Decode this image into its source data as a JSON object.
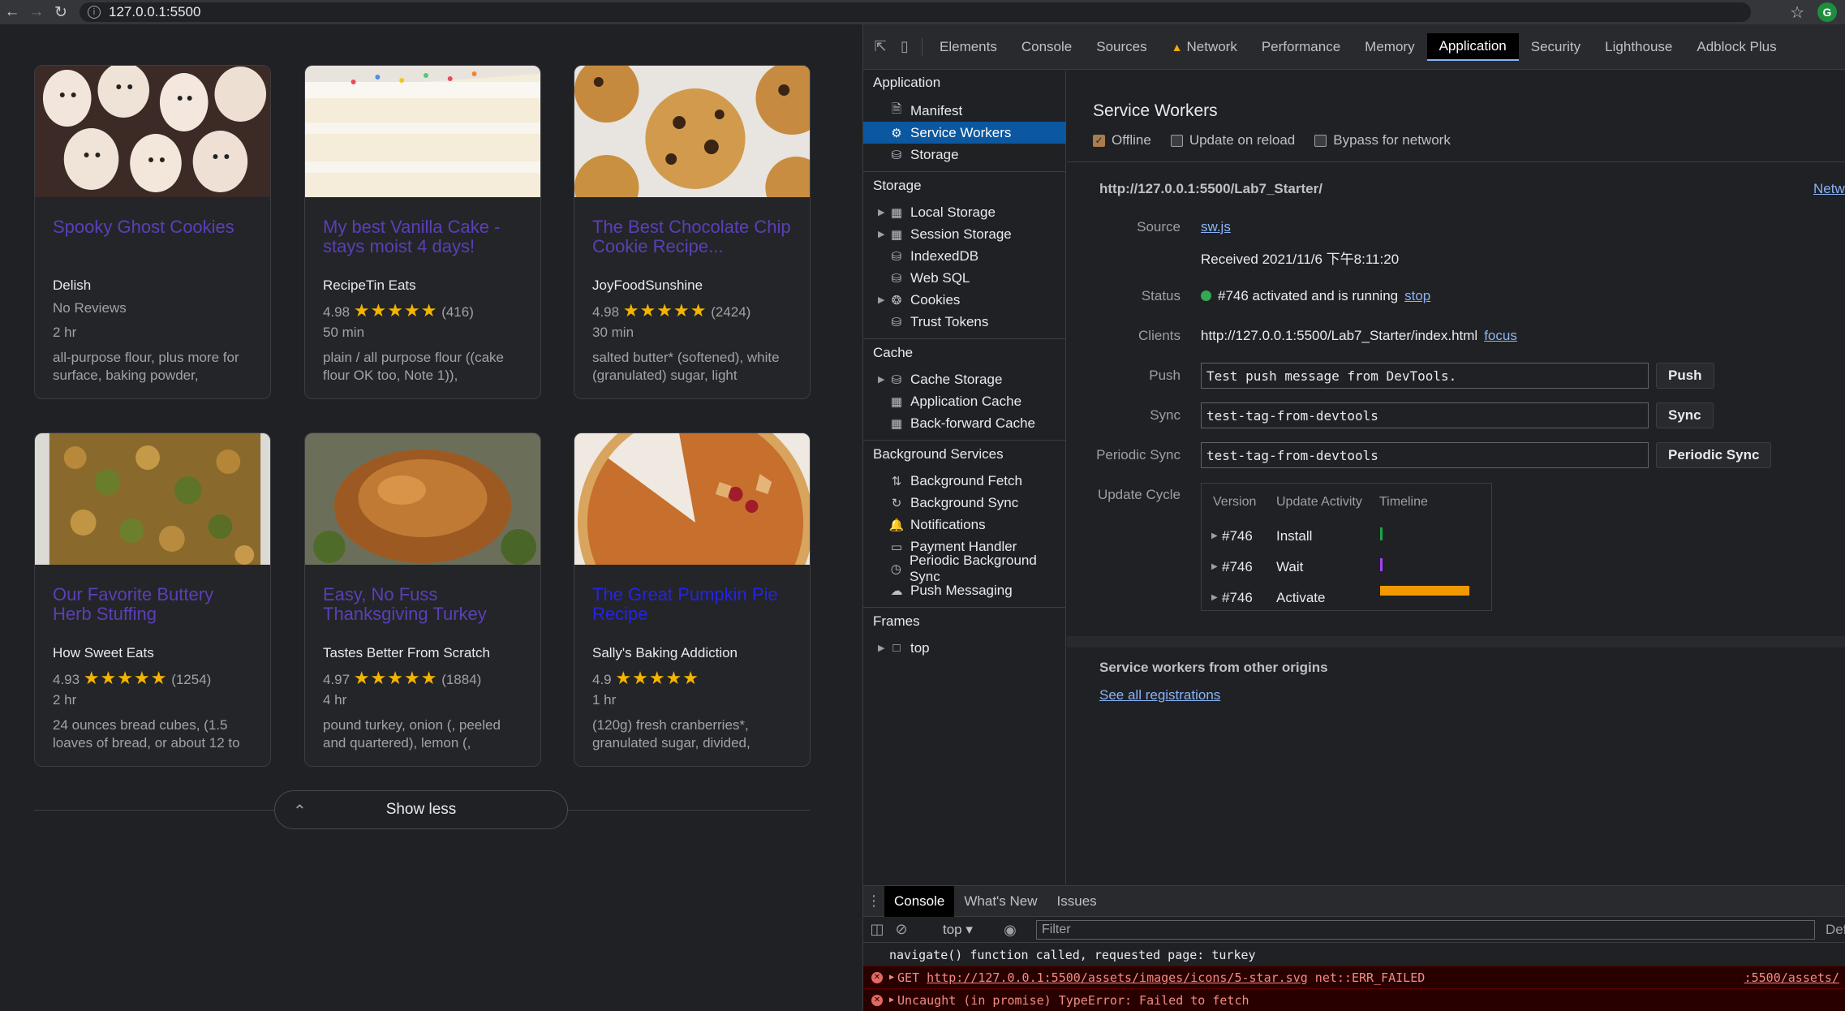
{
  "browser": {
    "url": "127.0.0.1:5500",
    "avatar_letter": "G"
  },
  "cards": [
    {
      "title": "Spooky Ghost Cookies",
      "org": "Delish",
      "rating": "No Reviews",
      "stars": "",
      "count": "",
      "time": "2 hr",
      "ingredients": "all-purpose flour, plus more for surface, baking powder,",
      "title_color": "purple"
    },
    {
      "title": "My best Vanilla Cake - stays moist 4 days!",
      "org": "RecipeTin Eats",
      "rating": "4.98",
      "stars": "★★★★★",
      "count": "(416)",
      "time": "50 min",
      "ingredients": "plain / all purpose flour ((cake flour OK too, Note 1)),",
      "title_color": "purple"
    },
    {
      "title": "The Best Chocolate Chip Cookie Recipe...",
      "org": "JoyFoodSunshine",
      "rating": "4.98",
      "stars": "★★★★★",
      "count": "(2424)",
      "time": "30 min",
      "ingredients": "salted butter* (softened), white (granulated) sugar, light",
      "title_color": "purple"
    },
    {
      "title": "Our Favorite Buttery Herb Stuffing",
      "org": "How Sweet Eats",
      "rating": "4.93",
      "stars": "★★★★★",
      "count": "(1254)",
      "time": "2 hr",
      "ingredients": "24 ounces bread cubes, (1.5 loaves of bread, or about 12 to",
      "title_color": "purple"
    },
    {
      "title": "Easy, No Fuss Thanksgiving Turkey",
      "org": "Tastes Better From Scratch",
      "rating": "4.97",
      "stars": "★★★★★",
      "count": "(1884)",
      "time": "4 hr",
      "ingredients": "pound turkey, onion (, peeled and quartered), lemon (,",
      "title_color": "purple"
    },
    {
      "title": "The Great Pumpkin Pie Recipe",
      "org": "Sally's Baking Addiction",
      "rating": "4.9",
      "stars": "★★★★★",
      "count": "",
      "time": "1 hr",
      "ingredients": "(120g) fresh cranberries*, granulated sugar, divided,",
      "title_color": "blue"
    }
  ],
  "show_less": "Show less",
  "devtools": {
    "tabs": [
      "Elements",
      "Console",
      "Sources",
      "Network",
      "Performance",
      "Memory",
      "Application",
      "Security",
      "Lighthouse",
      "Adblock Plus"
    ],
    "active_tab": "Application",
    "sidebar": {
      "application": {
        "head": "Application",
        "items": [
          "Manifest",
          "Service Workers",
          "Storage"
        ]
      },
      "storage": {
        "head": "Storage",
        "items": [
          "Local Storage",
          "Session Storage",
          "IndexedDB",
          "Web SQL",
          "Cookies",
          "Trust Tokens"
        ]
      },
      "cache": {
        "head": "Cache",
        "items": [
          "Cache Storage",
          "Application Cache",
          "Back-forward Cache"
        ]
      },
      "bg": {
        "head": "Background Services",
        "items": [
          "Background Fetch",
          "Background Sync",
          "Notifications",
          "Payment Handler",
          "Periodic Background Sync",
          "Push Messaging"
        ]
      },
      "frames": {
        "head": "Frames",
        "items": [
          "top"
        ]
      }
    },
    "sw": {
      "title": "Service Workers",
      "offline": "Offline",
      "update_on_reload": "Update on reload",
      "bypass": "Bypass for network",
      "origin": "http://127.0.0.1:5500/Lab7_Starter/",
      "network_link": "Netw",
      "source_label": "Source",
      "source_value": "sw.js",
      "received": "Received 2021/11/6 下午8:11:20",
      "status_label": "Status",
      "status_value": "#746 activated and is running",
      "stop": "stop",
      "clients_label": "Clients",
      "clients_value": "http://127.0.0.1:5500/Lab7_Starter/index.html",
      "focus": "focus",
      "push_label": "Push",
      "push_value": "Test push message from DevTools.",
      "push_btn": "Push",
      "sync_label": "Sync",
      "sync_value": "test-tag-from-devtools",
      "sync_btn": "Sync",
      "psync_label": "Periodic Sync",
      "psync_value": "test-tag-from-devtools",
      "psync_btn": "Periodic Sync",
      "cycle_label": "Update Cycle",
      "cycle_headers": [
        "Version",
        "Update Activity",
        "Timeline"
      ],
      "cycle_rows": [
        {
          "version": "#746",
          "activity": "Install"
        },
        {
          "version": "#746",
          "activity": "Wait"
        },
        {
          "version": "#746",
          "activity": "Activate"
        }
      ],
      "other_origins": "Service workers from other origins",
      "see_all": "See all registrations"
    },
    "drawer": {
      "tabs": [
        "Console",
        "What's New",
        "Issues"
      ],
      "context": "top",
      "filter_placeholder": "Filter",
      "default_levels": "Def",
      "log1": "navigate() function called, requested page: turkey",
      "err1_prefix": "GET",
      "err1_url": "http://127.0.0.1:5500/assets/images/icons/5-star.svg",
      "err1_msg": "net::ERR_FAILED",
      "err1_src": ":5500/assets/",
      "err2": "Uncaught (in promise) TypeError: Failed to fetch"
    }
  },
  "colors": {
    "title_purple": "#5b3fb8",
    "title_blue": "#2424e6",
    "star": "#f4b400",
    "selected": "#0b57a0",
    "activate_bar": "#f29900"
  }
}
